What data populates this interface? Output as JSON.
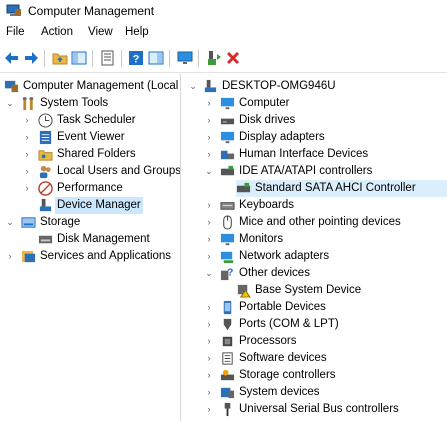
{
  "window": {
    "title": "Computer Management"
  },
  "menu": [
    "File",
    "Action",
    "View",
    "Help"
  ],
  "toolbar": {
    "icons": [
      "back-icon",
      "forward-icon",
      "up-folder-icon",
      "console-tree-icon",
      "export-icon",
      "help-icon",
      "properties-icon",
      "monitor-icon",
      "update-driver-icon",
      "uninstall-icon"
    ]
  },
  "left_tree": {
    "root": "Computer Management (Local",
    "system_tools": "System Tools",
    "task_scheduler": "Task Scheduler",
    "event_viewer": "Event Viewer",
    "shared_folders": "Shared Folders",
    "local_users": "Local Users and Groups",
    "performance": "Performance",
    "device_manager": "Device Manager",
    "storage": "Storage",
    "disk_management": "Disk Management",
    "services": "Services and Applications"
  },
  "right_tree": {
    "root": "DESKTOP-OMG946U",
    "computer": "Computer",
    "disk_drives": "Disk drives",
    "display_adapters": "Display adapters",
    "hid": "Human Interface Devices",
    "ide": "IDE ATA/ATAPI controllers",
    "sata": "Standard SATA AHCI Controller",
    "keyboards": "Keyboards",
    "mice": "Mice and other pointing devices",
    "monitors": "Monitors",
    "network": "Network adapters",
    "other": "Other devices",
    "base_system": "Base System Device",
    "portable": "Portable Devices",
    "ports": "Ports (COM & LPT)",
    "processors": "Processors",
    "software": "Software devices",
    "storage_ctrl": "Storage controllers",
    "system_devices": "System devices",
    "usb": "Universal Serial Bus controllers"
  },
  "colors": {
    "selection": "#cce8ff",
    "hover": "#dbeefc",
    "accent": "#1e6fc8",
    "delete": "#d62b2b"
  }
}
